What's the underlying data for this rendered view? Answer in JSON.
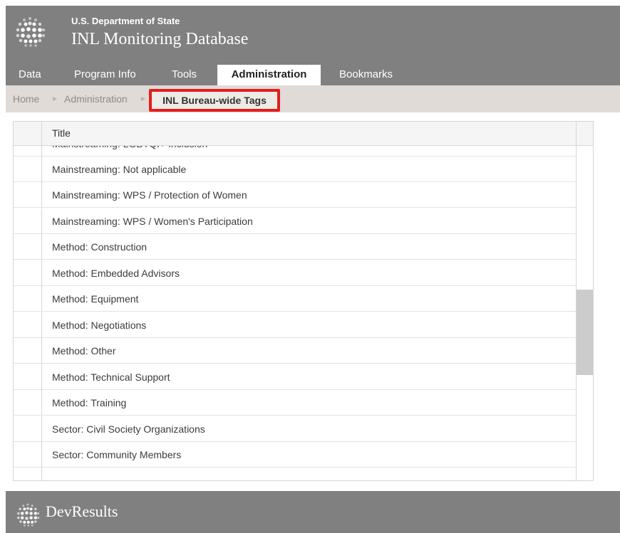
{
  "header": {
    "agency": "U.S. Department of State",
    "app_name": "INL Monitoring Database",
    "logo_icon": "globe-dots-icon"
  },
  "nav": {
    "items": [
      {
        "label": "Data",
        "active": false
      },
      {
        "label": "Program Info",
        "active": false
      },
      {
        "label": "Tools",
        "active": false
      },
      {
        "label": "Administration",
        "active": true
      },
      {
        "label": "Bookmarks",
        "active": false
      }
    ]
  },
  "breadcrumb": {
    "items": [
      "Home",
      "Administration"
    ],
    "current": "INL Bureau-wide Tags",
    "separator_icon": "caret-right-icon",
    "highlight_color": "#e41c1c"
  },
  "grid": {
    "column_header": "Title",
    "rows": [
      "Mainstreaming: LGBTQI+ Inclusion",
      "Mainstreaming: Not applicable",
      "Mainstreaming: WPS / Protection of Women",
      "Mainstreaming: WPS / Women's Participation",
      "Method: Construction",
      "Method: Embedded Advisors",
      "Method: Equipment",
      "Method: Negotiations",
      "Method: Other",
      "Method: Technical Support",
      "Method: Training",
      "Sector: Civil Society Organizations",
      "Sector: Community Members"
    ]
  },
  "footer": {
    "brand": "DevResults",
    "logo_icon": "globe-dots-icon"
  },
  "colors": {
    "header_bg": "#808080",
    "breadcrumb_bg": "#e0dbd7"
  }
}
